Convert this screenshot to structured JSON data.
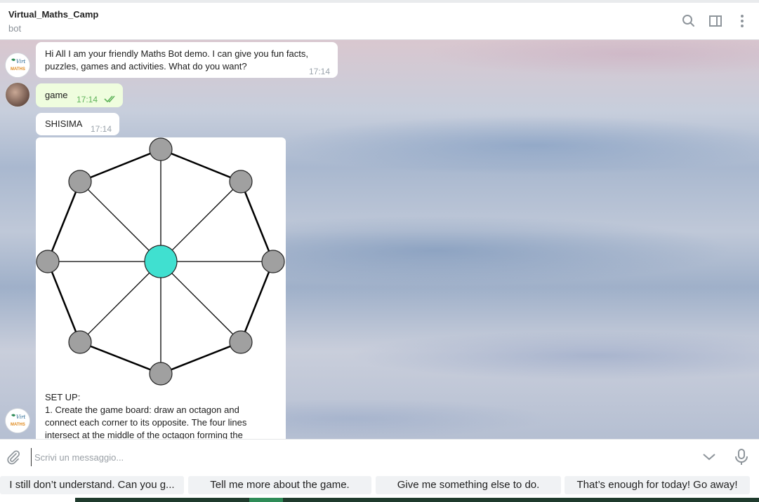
{
  "header": {
    "title": "Virtual_Maths_Camp",
    "subtitle": "bot",
    "icons": [
      "search-icon",
      "sidebar-toggle-icon",
      "more-vertical-icon"
    ]
  },
  "messages": [
    {
      "from": "bot",
      "text_line1": "Hi All I am your friendly Maths Bot demo. I can give you fun facts,",
      "text_line2": "puzzles, games and activities. What do you want?",
      "time": "17:14"
    },
    {
      "from": "user",
      "text": "game",
      "time": "17:14",
      "status": "read"
    },
    {
      "from": "bot",
      "text": "SHISIMA",
      "time": "17:14"
    },
    {
      "from": "bot",
      "type": "image-with-caption",
      "image_description": "shisima-board",
      "caption_lines": [
        "SET UP:",
        "1. Create the game board: draw an octagon and",
        "connect each corner to its opposite. The four lines",
        "intersect at the middle of the octagon forming the"
      ]
    }
  ],
  "avatar_logo_text": "Virt MATHS",
  "composer": {
    "placeholder": "Scrivi un messaggio...",
    "value": ""
  },
  "quick_replies": [
    "I still don’t understand. Can you g...",
    "Tell me more about the game.",
    "Give me something else to do.",
    "That’s enough for today! Go away!"
  ],
  "colors": {
    "board_center": "#40e0d0",
    "board_node": "#a0a0a0",
    "outgoing_bubble": "#effdde",
    "read_check": "#5fb35a"
  }
}
